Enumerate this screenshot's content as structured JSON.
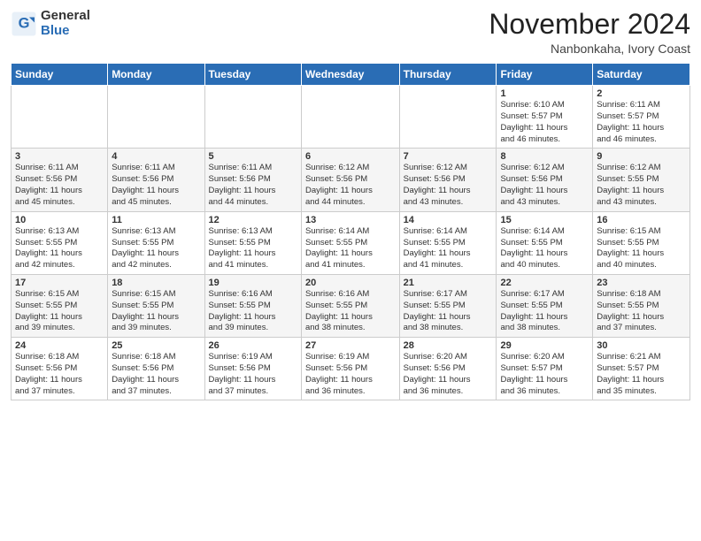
{
  "logo": {
    "general": "General",
    "blue": "Blue"
  },
  "header": {
    "month_year": "November 2024",
    "location": "Nanbonkaha, Ivory Coast"
  },
  "weekdays": [
    "Sunday",
    "Monday",
    "Tuesday",
    "Wednesday",
    "Thursday",
    "Friday",
    "Saturday"
  ],
  "weeks": [
    [
      {
        "day": "",
        "info": ""
      },
      {
        "day": "",
        "info": ""
      },
      {
        "day": "",
        "info": ""
      },
      {
        "day": "",
        "info": ""
      },
      {
        "day": "",
        "info": ""
      },
      {
        "day": "1",
        "info": "Sunrise: 6:10 AM\nSunset: 5:57 PM\nDaylight: 11 hours\nand 46 minutes."
      },
      {
        "day": "2",
        "info": "Sunrise: 6:11 AM\nSunset: 5:57 PM\nDaylight: 11 hours\nand 46 minutes."
      }
    ],
    [
      {
        "day": "3",
        "info": "Sunrise: 6:11 AM\nSunset: 5:56 PM\nDaylight: 11 hours\nand 45 minutes."
      },
      {
        "day": "4",
        "info": "Sunrise: 6:11 AM\nSunset: 5:56 PM\nDaylight: 11 hours\nand 45 minutes."
      },
      {
        "day": "5",
        "info": "Sunrise: 6:11 AM\nSunset: 5:56 PM\nDaylight: 11 hours\nand 44 minutes."
      },
      {
        "day": "6",
        "info": "Sunrise: 6:12 AM\nSunset: 5:56 PM\nDaylight: 11 hours\nand 44 minutes."
      },
      {
        "day": "7",
        "info": "Sunrise: 6:12 AM\nSunset: 5:56 PM\nDaylight: 11 hours\nand 43 minutes."
      },
      {
        "day": "8",
        "info": "Sunrise: 6:12 AM\nSunset: 5:56 PM\nDaylight: 11 hours\nand 43 minutes."
      },
      {
        "day": "9",
        "info": "Sunrise: 6:12 AM\nSunset: 5:55 PM\nDaylight: 11 hours\nand 43 minutes."
      }
    ],
    [
      {
        "day": "10",
        "info": "Sunrise: 6:13 AM\nSunset: 5:55 PM\nDaylight: 11 hours\nand 42 minutes."
      },
      {
        "day": "11",
        "info": "Sunrise: 6:13 AM\nSunset: 5:55 PM\nDaylight: 11 hours\nand 42 minutes."
      },
      {
        "day": "12",
        "info": "Sunrise: 6:13 AM\nSunset: 5:55 PM\nDaylight: 11 hours\nand 41 minutes."
      },
      {
        "day": "13",
        "info": "Sunrise: 6:14 AM\nSunset: 5:55 PM\nDaylight: 11 hours\nand 41 minutes."
      },
      {
        "day": "14",
        "info": "Sunrise: 6:14 AM\nSunset: 5:55 PM\nDaylight: 11 hours\nand 41 minutes."
      },
      {
        "day": "15",
        "info": "Sunrise: 6:14 AM\nSunset: 5:55 PM\nDaylight: 11 hours\nand 40 minutes."
      },
      {
        "day": "16",
        "info": "Sunrise: 6:15 AM\nSunset: 5:55 PM\nDaylight: 11 hours\nand 40 minutes."
      }
    ],
    [
      {
        "day": "17",
        "info": "Sunrise: 6:15 AM\nSunset: 5:55 PM\nDaylight: 11 hours\nand 39 minutes."
      },
      {
        "day": "18",
        "info": "Sunrise: 6:15 AM\nSunset: 5:55 PM\nDaylight: 11 hours\nand 39 minutes."
      },
      {
        "day": "19",
        "info": "Sunrise: 6:16 AM\nSunset: 5:55 PM\nDaylight: 11 hours\nand 39 minutes."
      },
      {
        "day": "20",
        "info": "Sunrise: 6:16 AM\nSunset: 5:55 PM\nDaylight: 11 hours\nand 38 minutes."
      },
      {
        "day": "21",
        "info": "Sunrise: 6:17 AM\nSunset: 5:55 PM\nDaylight: 11 hours\nand 38 minutes."
      },
      {
        "day": "22",
        "info": "Sunrise: 6:17 AM\nSunset: 5:55 PM\nDaylight: 11 hours\nand 38 minutes."
      },
      {
        "day": "23",
        "info": "Sunrise: 6:18 AM\nSunset: 5:55 PM\nDaylight: 11 hours\nand 37 minutes."
      }
    ],
    [
      {
        "day": "24",
        "info": "Sunrise: 6:18 AM\nSunset: 5:56 PM\nDaylight: 11 hours\nand 37 minutes."
      },
      {
        "day": "25",
        "info": "Sunrise: 6:18 AM\nSunset: 5:56 PM\nDaylight: 11 hours\nand 37 minutes."
      },
      {
        "day": "26",
        "info": "Sunrise: 6:19 AM\nSunset: 5:56 PM\nDaylight: 11 hours\nand 37 minutes."
      },
      {
        "day": "27",
        "info": "Sunrise: 6:19 AM\nSunset: 5:56 PM\nDaylight: 11 hours\nand 36 minutes."
      },
      {
        "day": "28",
        "info": "Sunrise: 6:20 AM\nSunset: 5:56 PM\nDaylight: 11 hours\nand 36 minutes."
      },
      {
        "day": "29",
        "info": "Sunrise: 6:20 AM\nSunset: 5:57 PM\nDaylight: 11 hours\nand 36 minutes."
      },
      {
        "day": "30",
        "info": "Sunrise: 6:21 AM\nSunset: 5:57 PM\nDaylight: 11 hours\nand 35 minutes."
      }
    ]
  ]
}
